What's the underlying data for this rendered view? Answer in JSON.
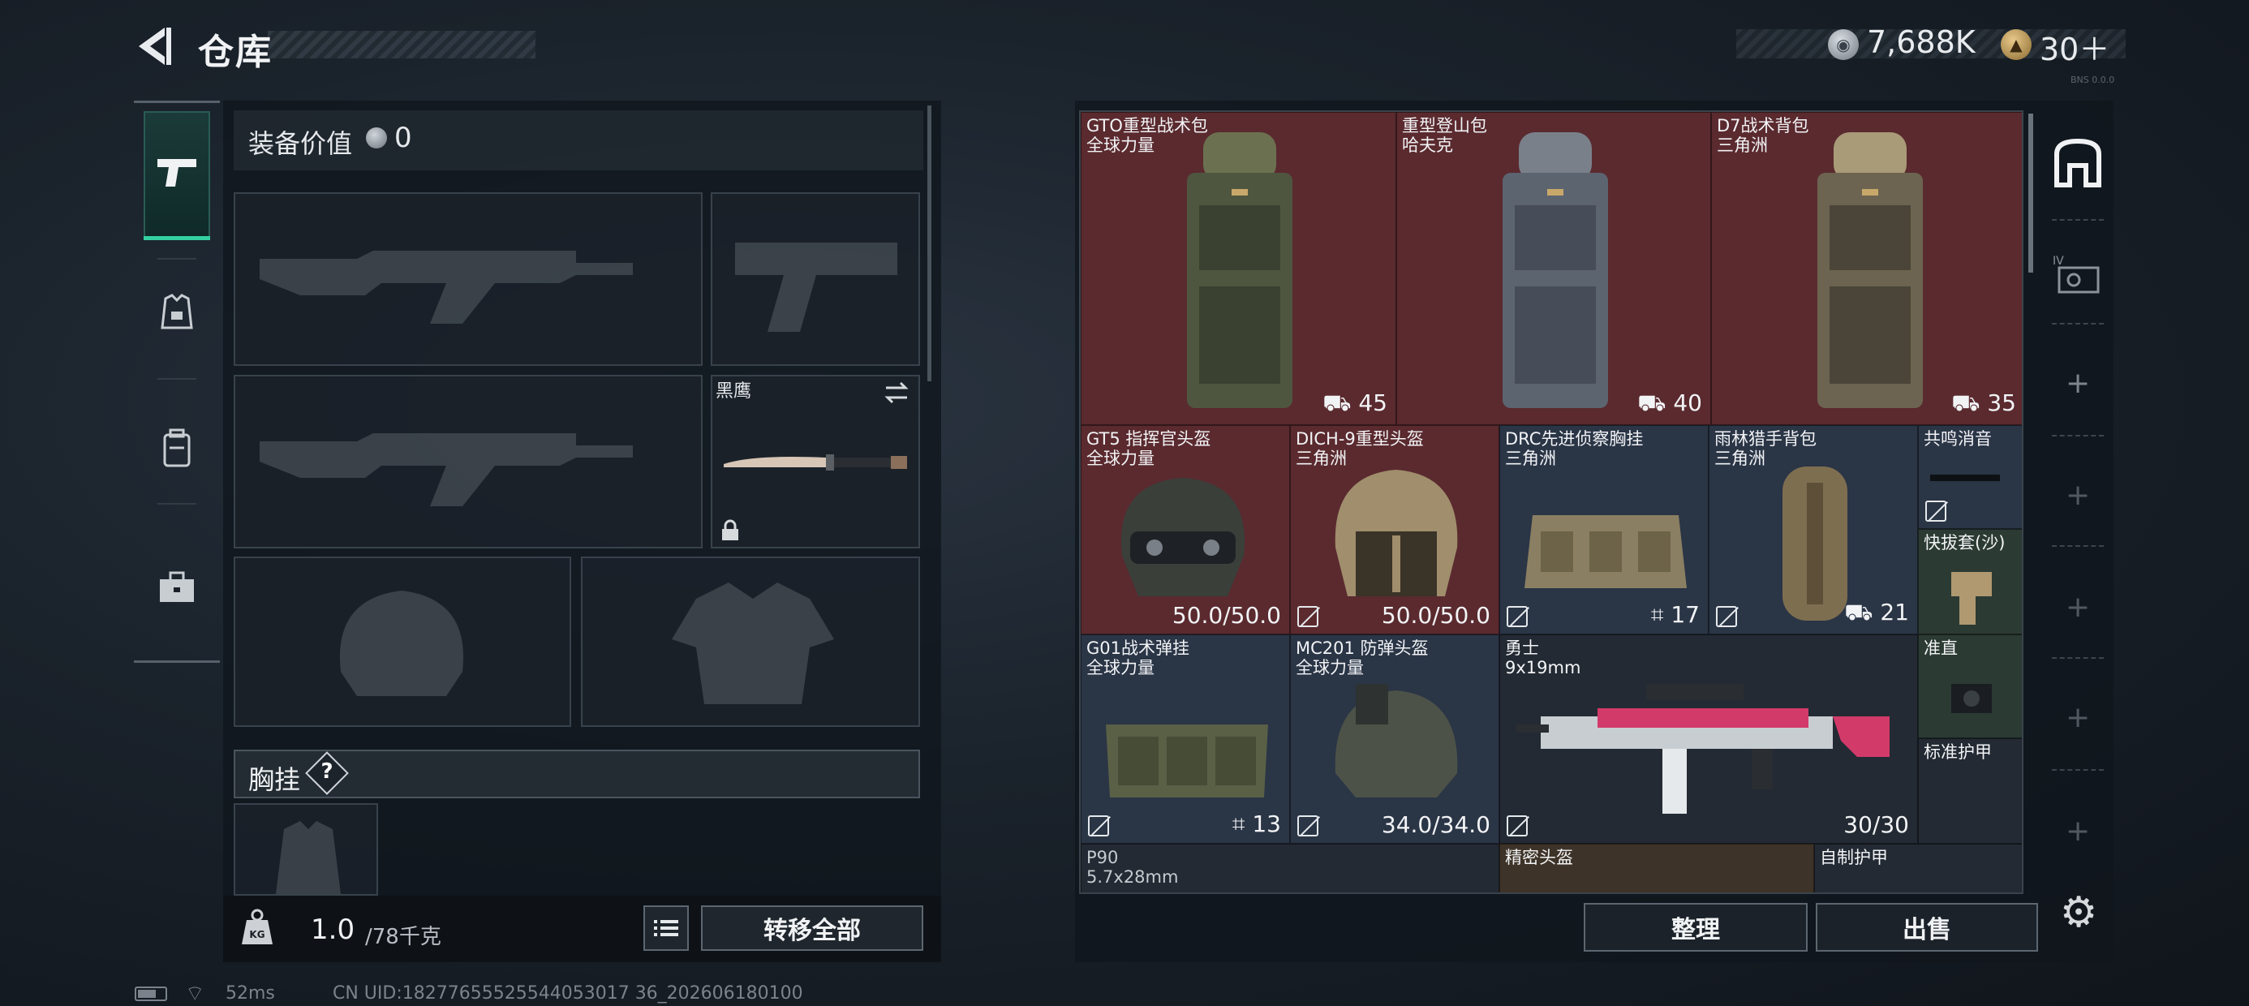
{
  "header": {
    "title": "仓库",
    "currency_silver": "7,688K",
    "currency_gold": "30＋",
    "build_tag": "BNS 0.0.0"
  },
  "left_tabs": [
    {
      "icon": "pistol-icon",
      "active": true
    },
    {
      "icon": "armor-vest-icon",
      "active": false
    },
    {
      "icon": "backpack-icon",
      "active": false
    },
    {
      "icon": "toolbox-icon",
      "active": false
    }
  ],
  "loadout": {
    "equip_value_label": "装备价值",
    "equip_value": "0",
    "knife_name": "黑鹰",
    "vest_label": "胸挂",
    "vest_help": "?",
    "weight_current": "1.0",
    "weight_max": "/78千克",
    "transfer_all": "转移全部"
  },
  "stash_items": [
    {
      "name": "GTO重型战术包",
      "sub": "全球力量",
      "count": "45",
      "rarity": "red"
    },
    {
      "name": "重型登山包",
      "sub": "哈夫克",
      "count": "40",
      "rarity": "red"
    },
    {
      "name": "D7战术背包",
      "sub": "三角洲",
      "count": "35",
      "rarity": "red"
    },
    {
      "name": "GT5 指挥官头盔",
      "sub": "全球力量",
      "count": "50.0/50.0",
      "rarity": "red"
    },
    {
      "name": "DICH-9重型头盔",
      "sub": "三角洲",
      "count": "50.0/50.0",
      "rarity": "red"
    },
    {
      "name": "DRC先进侦察胸挂",
      "sub": "三角洲",
      "count": "17",
      "rarity": "blue"
    },
    {
      "name": "雨林猎手背包",
      "sub": "三角洲",
      "count": "21",
      "rarity": "blue"
    },
    {
      "name": "共鸣消音",
      "sub": "",
      "count": "",
      "rarity": "blue"
    },
    {
      "name": "快拔套(沙)",
      "sub": "",
      "count": "",
      "rarity": "green"
    },
    {
      "name": "G01战术弹挂",
      "sub": "全球力量",
      "count": "13",
      "rarity": "blue"
    },
    {
      "name": "MC201 防弹头盔",
      "sub": "全球力量",
      "count": "34.0/34.0",
      "rarity": "blue"
    },
    {
      "name": "勇士",
      "sub": "9x19mm",
      "count": "30/30",
      "rarity": "dark"
    },
    {
      "name": "准直",
      "sub": "",
      "count": "",
      "rarity": "green"
    },
    {
      "name": "标准护甲",
      "sub": "",
      "count": "",
      "rarity": "dark"
    },
    {
      "name": "P90",
      "sub": "5.7x28mm",
      "count": "",
      "rarity": "dark"
    },
    {
      "name": "精密头盔",
      "sub": "",
      "count": "",
      "rarity": "brown"
    },
    {
      "name": "自制护甲",
      "sub": "",
      "count": "",
      "rarity": "dark"
    }
  ],
  "actions": {
    "sort": "整理",
    "sell": "出售"
  },
  "status": {
    "ping": "52ms",
    "uid": "CN UID:18277655525544053017 36_202606180100"
  }
}
